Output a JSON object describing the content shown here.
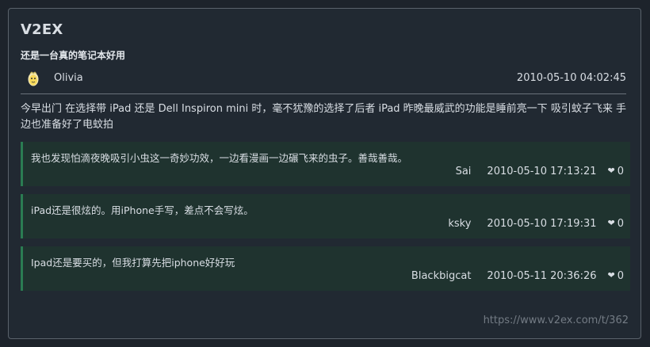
{
  "site": {
    "title": "V2EX"
  },
  "topic": {
    "title": "还是一台真的笔记本好用",
    "author": "Olivia",
    "time": "2010-05-10 04:02:45",
    "body": "今早出门 在选择带 iPad 还是 Dell Inspiron mini 时，毫不犹豫的选择了后者 iPad 昨晚最威武的功能是睡前亮一下 吸引蚊子飞来 手边也准备好了电蚊拍"
  },
  "replies": [
    {
      "text": "我也发现怕滴夜晚吸引小虫这一奇妙功效，一边看漫画一边碾飞来的虫子。善哉善哉。",
      "user": "Sai",
      "time": "2010-05-10 17:13:21",
      "likes": "0"
    },
    {
      "text": "iPad还是很炫的。用iPhone手写，差点不会写炫。",
      "user": "ksky",
      "time": "2010-05-10 17:19:31",
      "likes": "0"
    },
    {
      "text": "Ipad还是要买的，但我打算先把iphone好好玩",
      "user": "Blackbigcat",
      "time": "2010-05-11 20:36:26",
      "likes": "0"
    }
  ],
  "source": {
    "url": "https://www.v2ex.com/t/362"
  },
  "icons": {
    "avatar": "avatar-icon",
    "heart": "heart-icon"
  },
  "colors": {
    "background": "#1d232b",
    "card": "#212932",
    "reply_bg": "#1f332f",
    "reply_accent": "#2a7c52",
    "muted": "#737b84"
  }
}
